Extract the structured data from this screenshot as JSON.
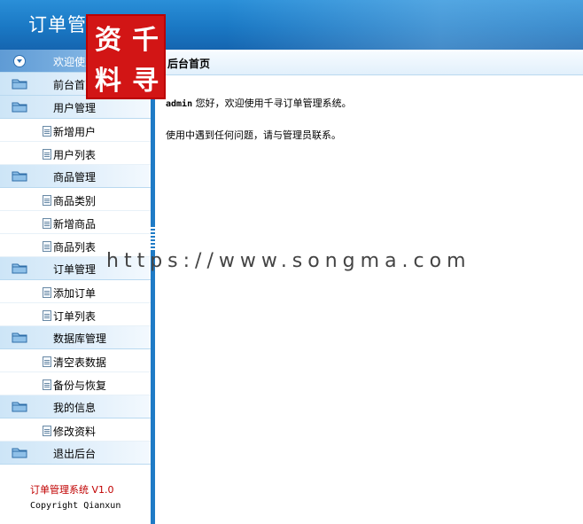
{
  "header": {
    "title": "订单管理系统"
  },
  "seal": {
    "chars": [
      "资",
      "千",
      "料",
      "寻"
    ],
    "color": "#d21515"
  },
  "sidebar": {
    "items": [
      {
        "type": "category",
        "label": "欢迎使用",
        "icon": "collapse-circle-icon"
      },
      {
        "type": "category",
        "label": "前台首页",
        "icon": "folder-icon"
      },
      {
        "type": "category",
        "label": "用户管理",
        "icon": "folder-icon"
      },
      {
        "type": "sub",
        "label": "新增用户",
        "icon": "document-icon"
      },
      {
        "type": "sub",
        "label": "用户列表",
        "icon": "document-icon"
      },
      {
        "type": "category",
        "label": "商品管理",
        "icon": "folder-icon"
      },
      {
        "type": "sub",
        "label": "商品类别",
        "icon": "document-icon"
      },
      {
        "type": "sub",
        "label": "新增商品",
        "icon": "document-icon"
      },
      {
        "type": "sub",
        "label": "商品列表",
        "icon": "document-icon"
      },
      {
        "type": "category",
        "label": "订单管理",
        "icon": "folder-icon"
      },
      {
        "type": "sub",
        "label": "添加订单",
        "icon": "document-icon"
      },
      {
        "type": "sub",
        "label": "订单列表",
        "icon": "document-icon"
      },
      {
        "type": "category",
        "label": "数据库管理",
        "icon": "folder-icon"
      },
      {
        "type": "sub",
        "label": "清空表数据",
        "icon": "document-icon"
      },
      {
        "type": "sub",
        "label": "备份与恢复",
        "icon": "document-icon"
      },
      {
        "type": "category",
        "label": "我的信息",
        "icon": "folder-icon"
      },
      {
        "type": "sub",
        "label": "修改资料",
        "icon": "document-icon"
      },
      {
        "type": "category",
        "label": "退出后台",
        "icon": "folder-icon"
      }
    ],
    "footer": {
      "version": "订单管理系统 V1.0",
      "copyright": "Copyright Qianxun"
    }
  },
  "content": {
    "breadcrumb": "后台首页",
    "user": "admin",
    "greeting": " 您好，欢迎使用千寻订单管理系统。",
    "help": "使用中遇到任何问题，请与管理员联系。"
  },
  "watermark": "https://www.songma.com"
}
